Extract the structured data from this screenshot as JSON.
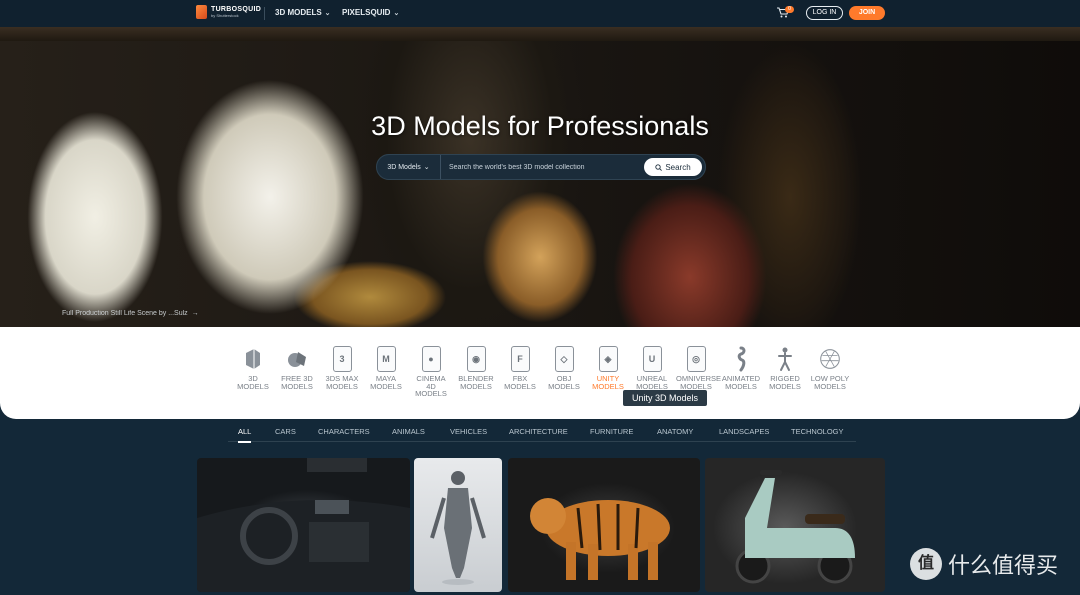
{
  "nav": {
    "brand": "TURBOSQUID",
    "brand_sub": "by Shutterstock",
    "menus": [
      "3D MODELS",
      "PIXELSQUID"
    ],
    "cart_count": "0",
    "login_label": "LOG IN",
    "join_label": "JOIN"
  },
  "hero": {
    "title": "3D Models for Professionals",
    "search": {
      "category": "3D Models",
      "placeholder": "Search the world's best 3D model collection",
      "button_label": "Search"
    },
    "caption": "Full Production Still Life Scene by ...Sulz"
  },
  "categories": [
    {
      "label": "3D MODELS",
      "icon": "cube-icon"
    },
    {
      "label": "FREE 3D MODELS",
      "icon": "free-3d-icon"
    },
    {
      "label": "3DS MAX MODELS",
      "icon": "3ds-max-icon",
      "glyph": "3"
    },
    {
      "label": "MAYA MODELS",
      "icon": "maya-icon",
      "glyph": "M"
    },
    {
      "label": "CINEMA 4D MODELS",
      "icon": "cinema4d-icon",
      "glyph": "●"
    },
    {
      "label": "BLENDER MODELS",
      "icon": "blender-icon",
      "glyph": "◉"
    },
    {
      "label": "FBX MODELS",
      "icon": "fbx-icon",
      "glyph": "F"
    },
    {
      "label": "OBJ MODELS",
      "icon": "obj-icon",
      "glyph": "◇"
    },
    {
      "label": "UNITY MODELS",
      "icon": "unity-icon",
      "glyph": "◈"
    },
    {
      "label": "UNREAL MODELS",
      "icon": "unreal-icon",
      "glyph": "U"
    },
    {
      "label": "OMNIVERSE MODELS",
      "icon": "omniverse-icon",
      "glyph": "◎"
    },
    {
      "label": "ANIMATED MODELS",
      "icon": "animated-icon"
    },
    {
      "label": "RIGGED MODELS",
      "icon": "rigged-icon"
    },
    {
      "label": "LOW POLY MODELS",
      "icon": "low-poly-icon"
    }
  ],
  "tooltip": "Unity 3D Models",
  "tabs": [
    "ALL",
    "CARS",
    "CHARACTERS",
    "ANIMALS",
    "VEHICLES",
    "ARCHITECTURE",
    "FURNITURE",
    "ANATOMY",
    "LANDSCAPES",
    "TECHNOLOGY"
  ],
  "watermark": {
    "badge": "值",
    "text": "什么值得买"
  },
  "colors": {
    "accent": "#ff7a2b",
    "nav_bg": "#10212f",
    "page_bg": "#132838"
  }
}
